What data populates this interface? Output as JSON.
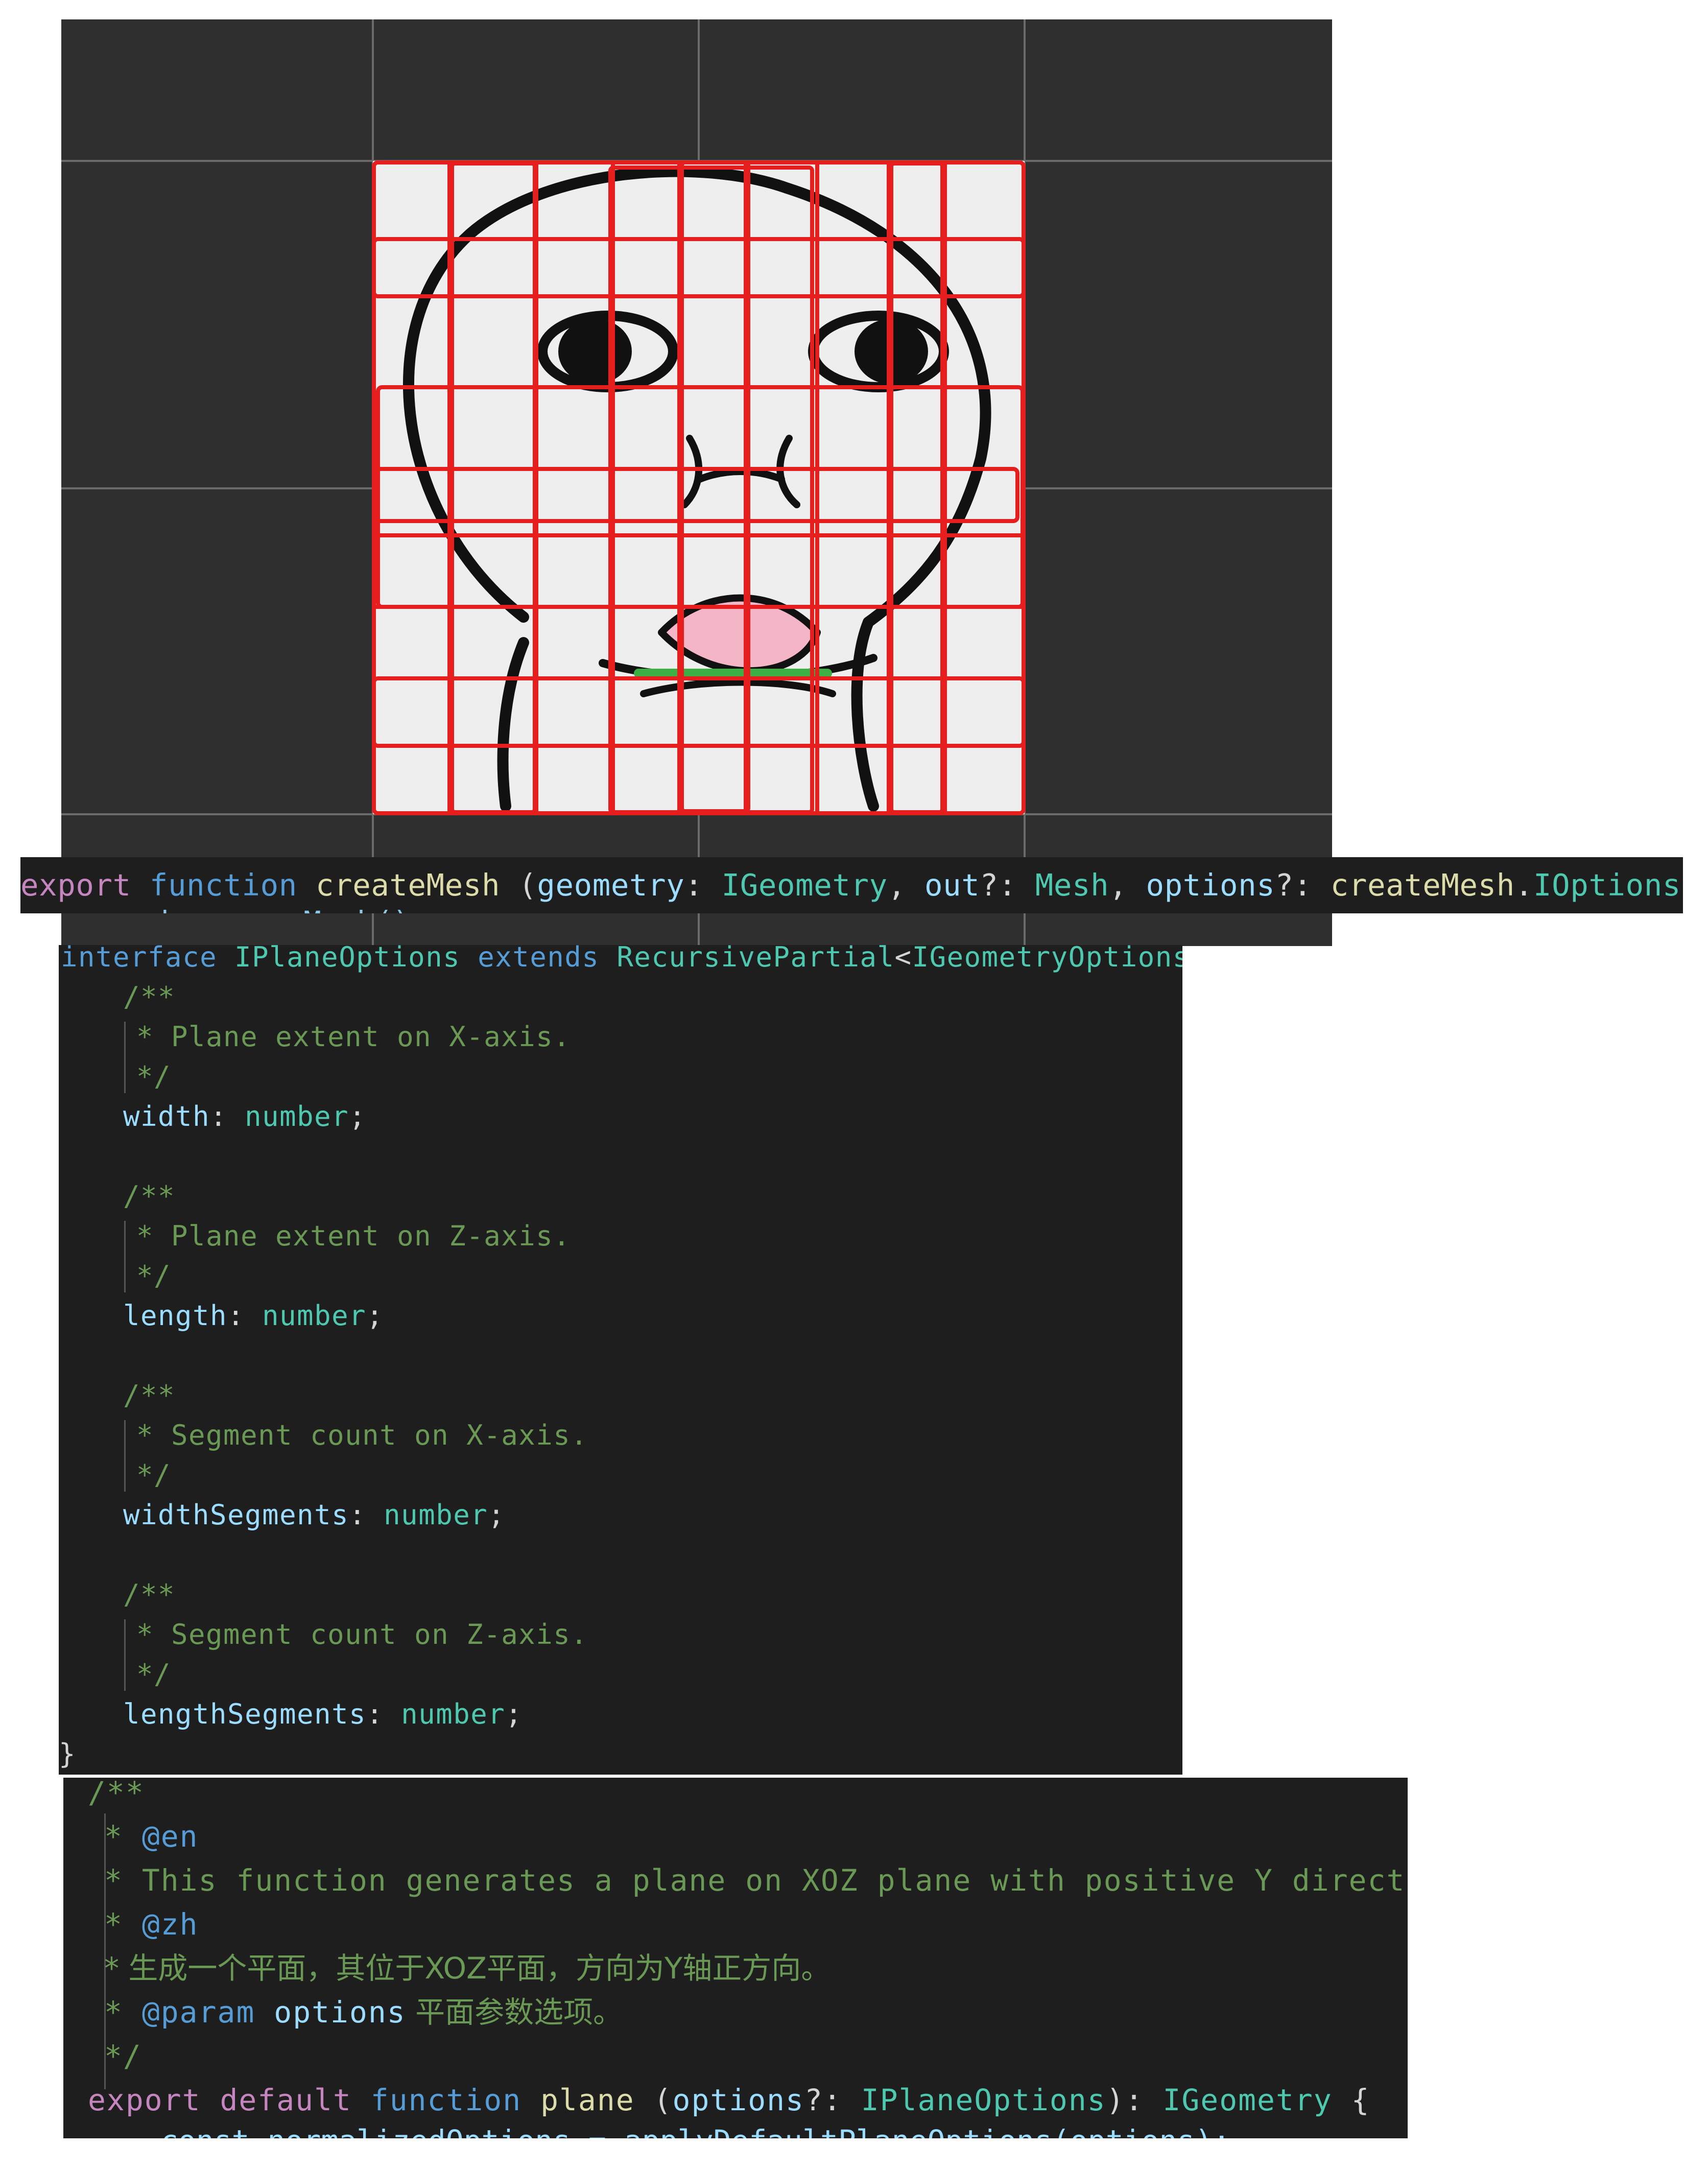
{
  "signature": {
    "export_kw": "export",
    "function_kw": "function",
    "fn_name": "createMesh",
    "open_paren": " (",
    "p1_name": "geometry",
    "p1_sep": ": ",
    "p1_type": "IGeometry",
    "p2_sep_before": ", ",
    "p2_name": "out",
    "p2_sep": "?: ",
    "p2_type": "Mesh",
    "p3_sep_before": ", ",
    "p3_name": "options",
    "p3_sep": "?: ",
    "p3_type_ns": "createMesh",
    "p3_dot": ".",
    "p3_type": "IOptions",
    "close": ") {",
    "cut_line": "mesh = new Mesh()"
  },
  "interface_block": {
    "kw_interface": "interface",
    "name": "IPlaneOptions",
    "kw_extends": "extends",
    "base": "RecursivePartial",
    "lt": "<",
    "generic": "IGeometryOptions",
    "gt": ">",
    "brace": " {",
    "comment_open": "/**",
    "comment_close": "*/",
    "fields": [
      {
        "doc": "* Plane extent on X-axis.",
        "name": "width",
        "type": "number"
      },
      {
        "doc": "* Plane extent on Z-axis.",
        "name": "length",
        "type": "number"
      },
      {
        "doc": "* Segment count on X-axis.",
        "name": "widthSegments",
        "type": "number"
      },
      {
        "doc": "* Segment count on Z-axis.",
        "name": "lengthSegments",
        "type": "number"
      }
    ],
    "colon": ": ",
    "semicolon": ";",
    "end_brace": "}"
  },
  "plane_block": {
    "open": "/**",
    "star": "* ",
    "en_tag": "@en",
    "en_text": "* This function generates a plane on XOZ plane with positive Y direction.",
    "zh_tag": "@zh",
    "zh_text": "* 生成一个平面，其位于XOZ平面，方向为Y轴正方向。",
    "param_tag": "@param",
    "param_name": "options",
    "param_desc": " 平面参数选项。",
    "close": "*/",
    "export_kw": "export",
    "default_kw": "default",
    "function_kw": "function",
    "fn_name": "plane",
    "open_paren": " (",
    "arg_name": "options",
    "arg_sep": "?: ",
    "arg_type": "IPlaneOptions",
    "ret_sep": "): ",
    "ret_type": "IGeometry",
    "brace": " {",
    "cut_line": "const normalizedOptions = applyDefaultPlaneOptions(options);"
  },
  "colors": {
    "viewport_bg": "#2f2f2f",
    "code_bg": "#1e1e1e",
    "mesh_red": "#e61e1e",
    "keyword": "#c586c0",
    "storage": "#569cd6",
    "function": "#dcdcaa",
    "variable": "#9cdcfe",
    "type": "#4ec9b0",
    "comment": "#6a9955"
  }
}
